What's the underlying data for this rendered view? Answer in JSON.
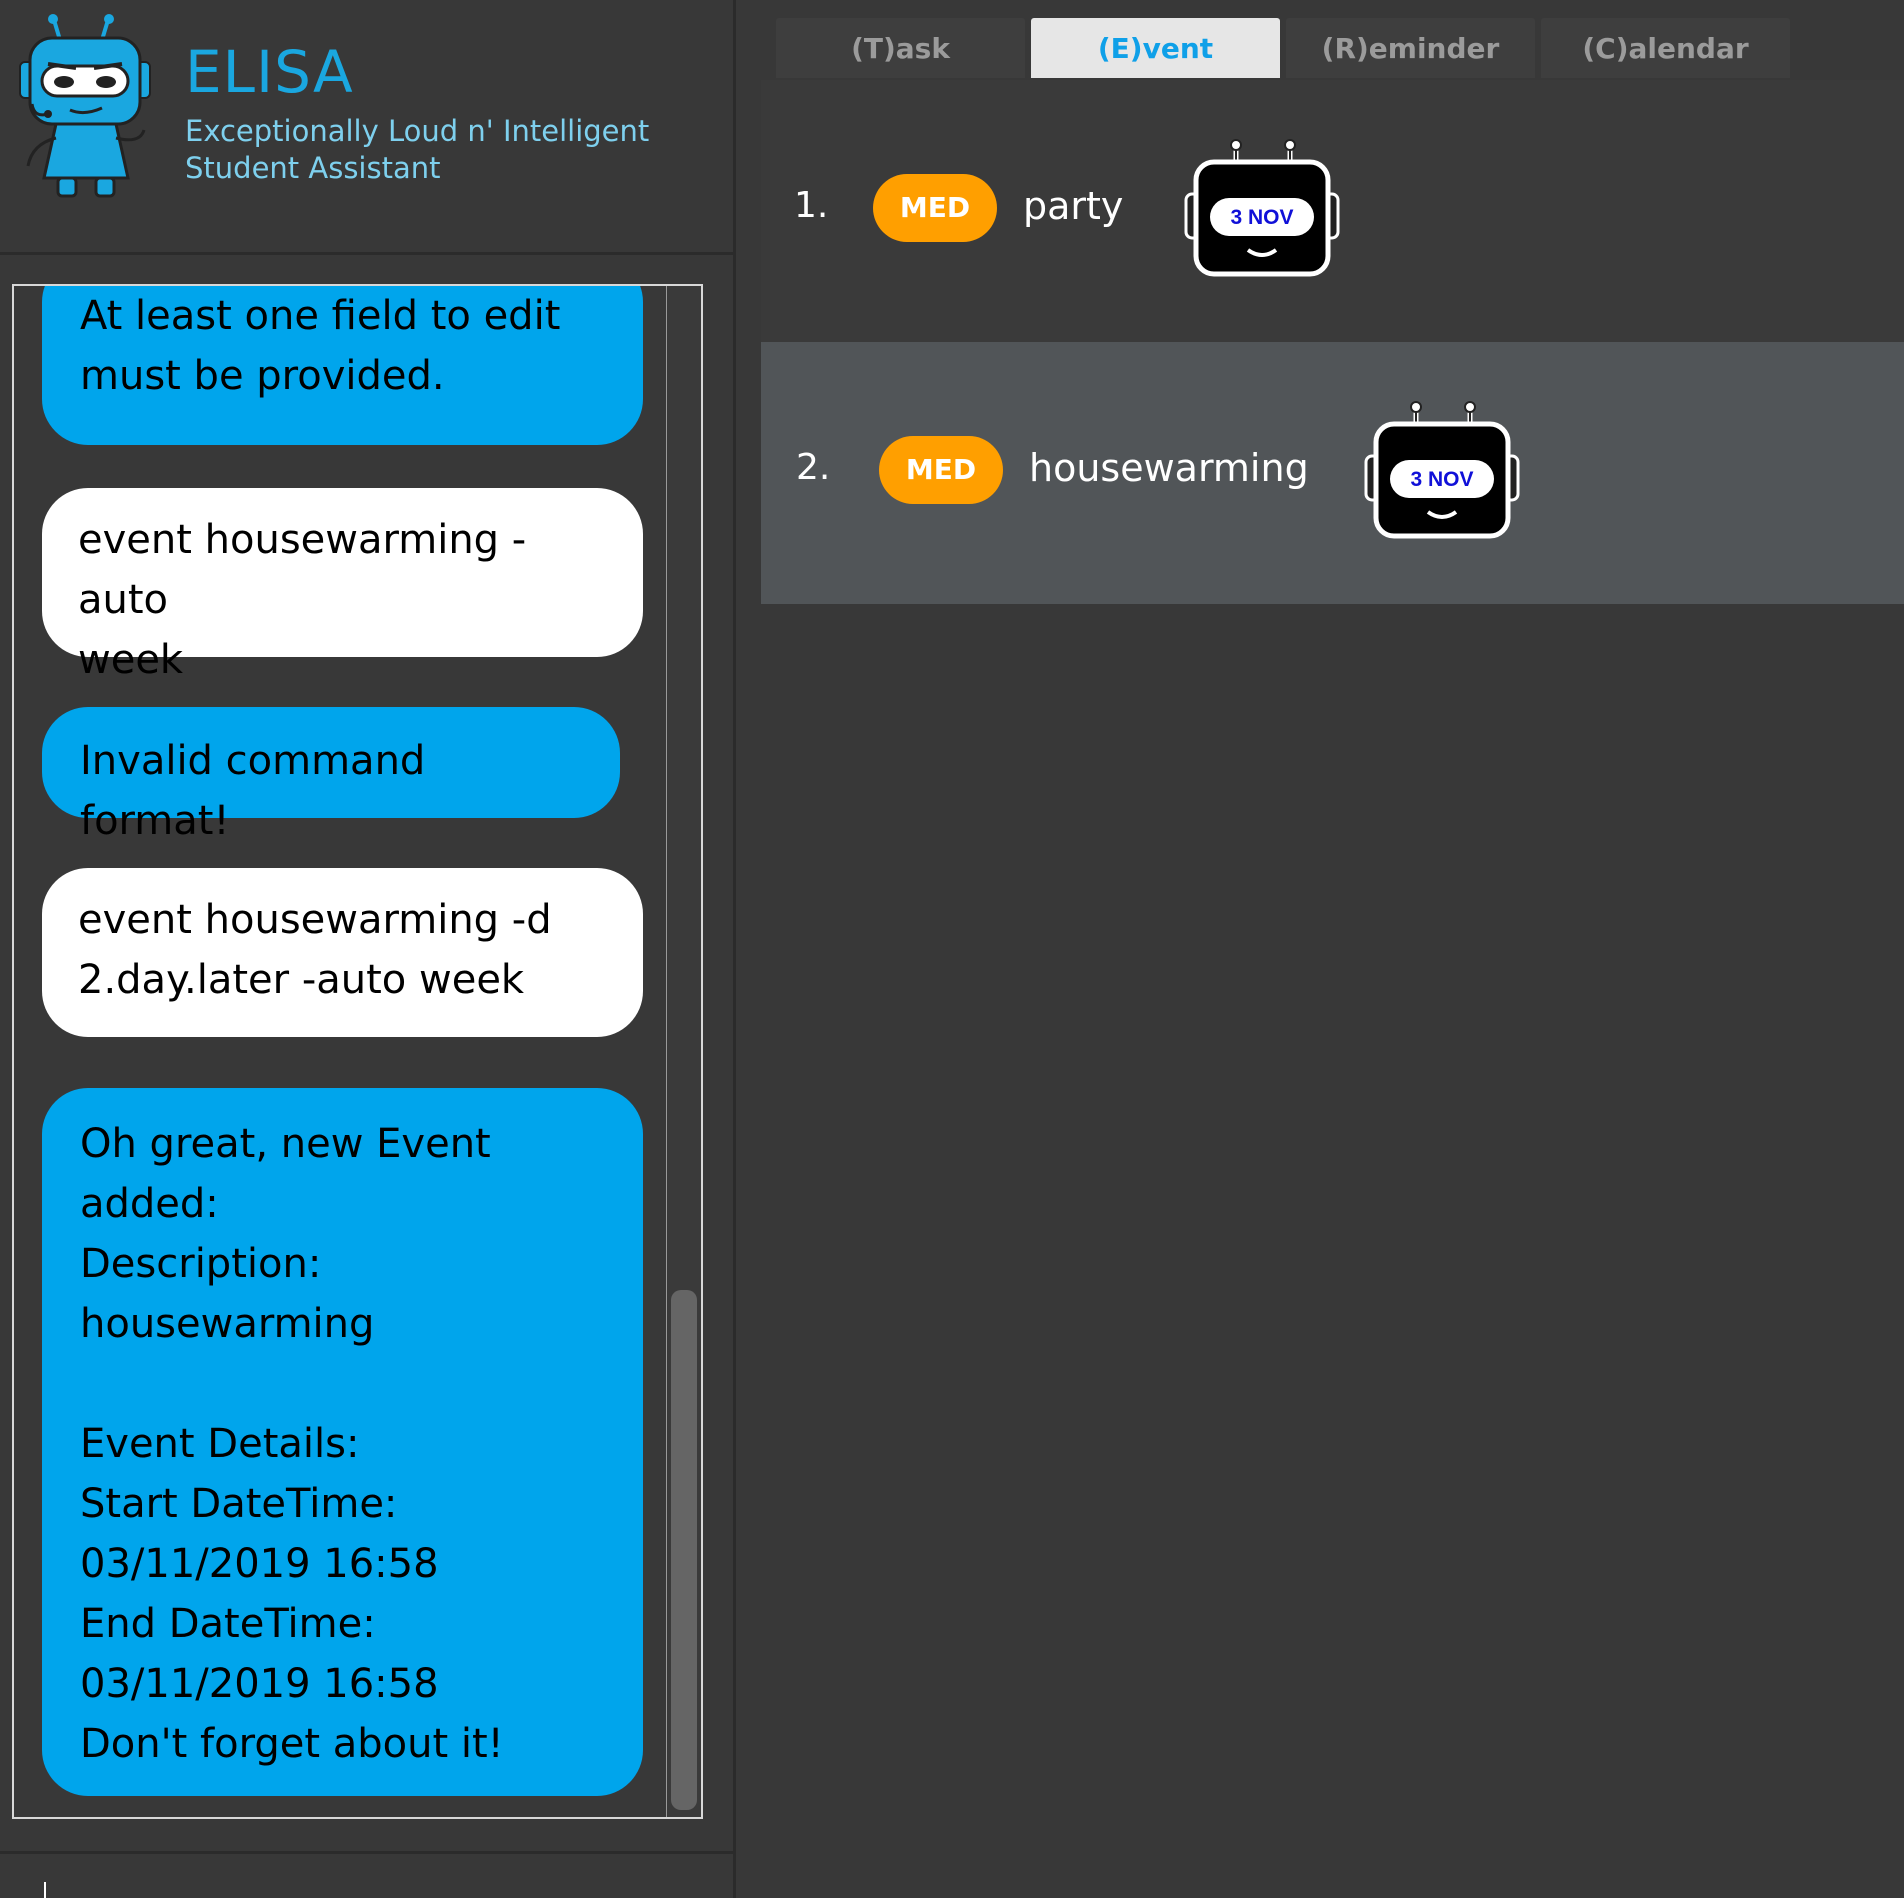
{
  "app": {
    "title": "ELISA",
    "subtitle_line1": "Exceptionally Loud n' Intelligent",
    "subtitle_line2": "Student Assistant",
    "logo_icon": "robot-mascot-icon",
    "colors": {
      "background": "#383838",
      "accent": "#1aa7e0",
      "elisa_bubble": "#00a5ec",
      "user_bubble": "#ffffff",
      "priority_med": "#ff9f00",
      "active_tab_bg": "#e6e6e6",
      "active_tab_text": "#0fa0e8"
    }
  },
  "chat": {
    "messages": [
      {
        "sender": "elisa",
        "text": "At least one field to edit\nmust be provided."
      },
      {
        "sender": "user",
        "text": "event housewarming -auto\nweek"
      },
      {
        "sender": "elisa",
        "text": "Invalid command format!"
      },
      {
        "sender": "user",
        "text": "event housewarming -d\n2.day.later -auto week"
      },
      {
        "sender": "elisa",
        "text": "Oh great, new Event\nadded:\nDescription:\nhousewarming\n\nEvent Details:\nStart DateTime:\n03/11/2019 16:58\nEnd DateTime:\n03/11/2019 16:58\nDon't forget about it!"
      }
    ]
  },
  "command_box": {
    "value": "",
    "placeholder": ""
  },
  "tabs": [
    {
      "label": "(T)ask",
      "active": false
    },
    {
      "label": "(E)vent",
      "active": true
    },
    {
      "label": "(R)eminder",
      "active": false
    },
    {
      "label": "(C)alendar",
      "active": false
    }
  ],
  "events": [
    {
      "index": "1.",
      "priority": "MED",
      "description": "party",
      "date_badge": "3 NOV",
      "badge_icon": "robot-date-icon"
    },
    {
      "index": "2.",
      "priority": "MED",
      "description": "housewarming",
      "date_badge": "3 NOV",
      "badge_icon": "robot-date-icon"
    }
  ]
}
